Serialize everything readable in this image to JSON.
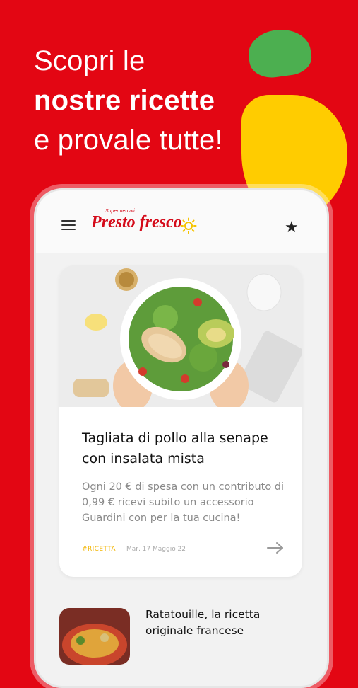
{
  "promo": {
    "line1": "Scopri le",
    "line2": "nostre ricette",
    "line3": "e provale tutte!"
  },
  "app": {
    "logo_super": "Supermercati",
    "logo_brand": "Presto fresco"
  },
  "featured": {
    "title": "Tagliata di pollo alla senape con insalata mista",
    "description": "Ogni 20 € di spesa con un contributo di 0,99 € ricevi subito un accessorio Guardini con per la tua cucina!",
    "tag": "#RICETTA",
    "separator": "|",
    "date": "Mar, 17 Maggio 22"
  },
  "next_item": {
    "title": "Ratatouille, la ricetta originale francese"
  },
  "colors": {
    "background": "#e30613",
    "accent_yellow": "#ffcc00",
    "accent_green": "#4caf50",
    "brand_red": "#d40b1a"
  },
  "icons": {
    "menu": "hamburger-menu-icon",
    "favorites": "star-icon",
    "go": "arrow-right-icon",
    "logo_sun": "sun-icon"
  }
}
